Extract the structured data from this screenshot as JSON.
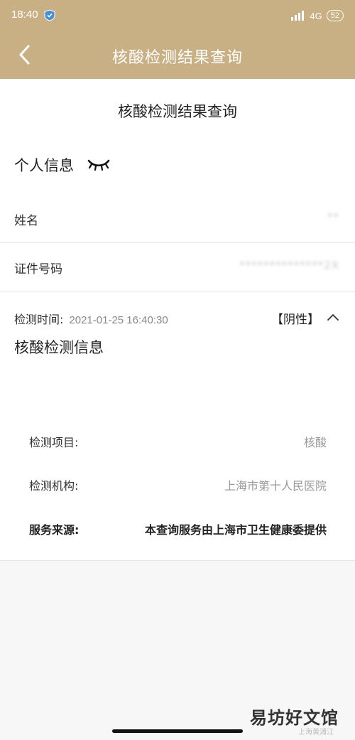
{
  "status_bar": {
    "time": "18:40",
    "network": "4G",
    "battery": "52"
  },
  "navbar": {
    "title": "核酸检测结果查询"
  },
  "page": {
    "title": "核酸检测结果查询"
  },
  "personal_info": {
    "heading": "个人信息",
    "name_label": "姓名",
    "name_value": "**",
    "id_label": "证件号码",
    "id_value": "**************2X"
  },
  "test_info": {
    "heading": "核酸检测信息",
    "time_label": "检测时间:",
    "time_value": "2021-01-25 16:40:30",
    "result": "【阴性】",
    "details": [
      {
        "label": "检测项目:",
        "value": "核酸"
      },
      {
        "label": "检测机构:",
        "value": "上海市第十人民医院"
      },
      {
        "label": "服务来源:",
        "value": "本查询服务由上海市卫生健康委提供"
      }
    ]
  },
  "watermark": {
    "text": "易坊好文馆",
    "small": "上海黄浦江"
  },
  "colors": {
    "header": "#c9b084",
    "background": "#f7f7f7"
  },
  "icons": [
    "shield-icon",
    "signal-icon",
    "back-arrow-icon",
    "closed-eye-icon",
    "chevron-up-icon"
  ]
}
